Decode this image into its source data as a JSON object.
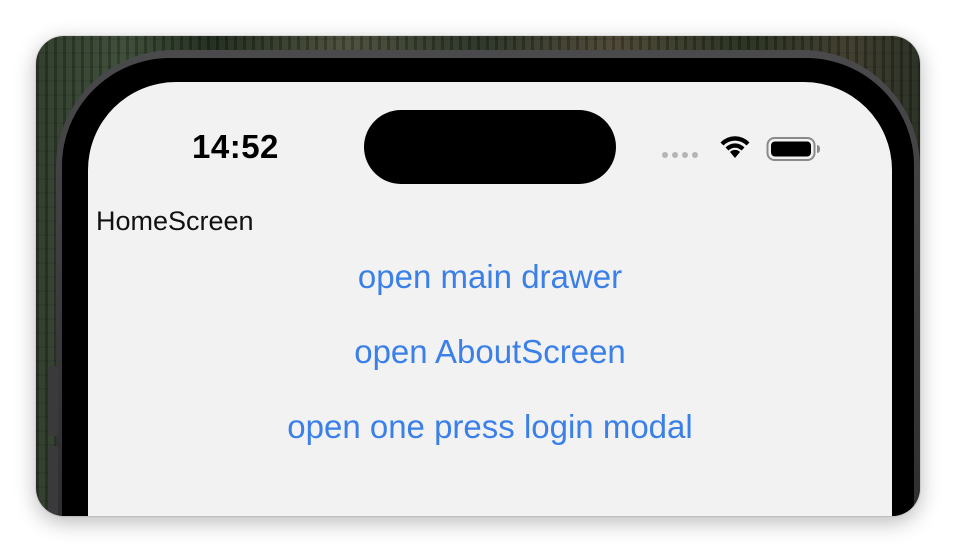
{
  "status_bar": {
    "time": "14:52",
    "icons": [
      "signal-dots-icon",
      "wifi-icon",
      "battery-icon"
    ]
  },
  "screen": {
    "title": "HomeScreen",
    "actions": [
      {
        "label": "open main drawer"
      },
      {
        "label": "open AboutScreen"
      },
      {
        "label": "open one press login modal"
      }
    ]
  },
  "colors": {
    "link": "#3a80e8",
    "screen_background": "#f2f2f2",
    "text": "#111111"
  }
}
